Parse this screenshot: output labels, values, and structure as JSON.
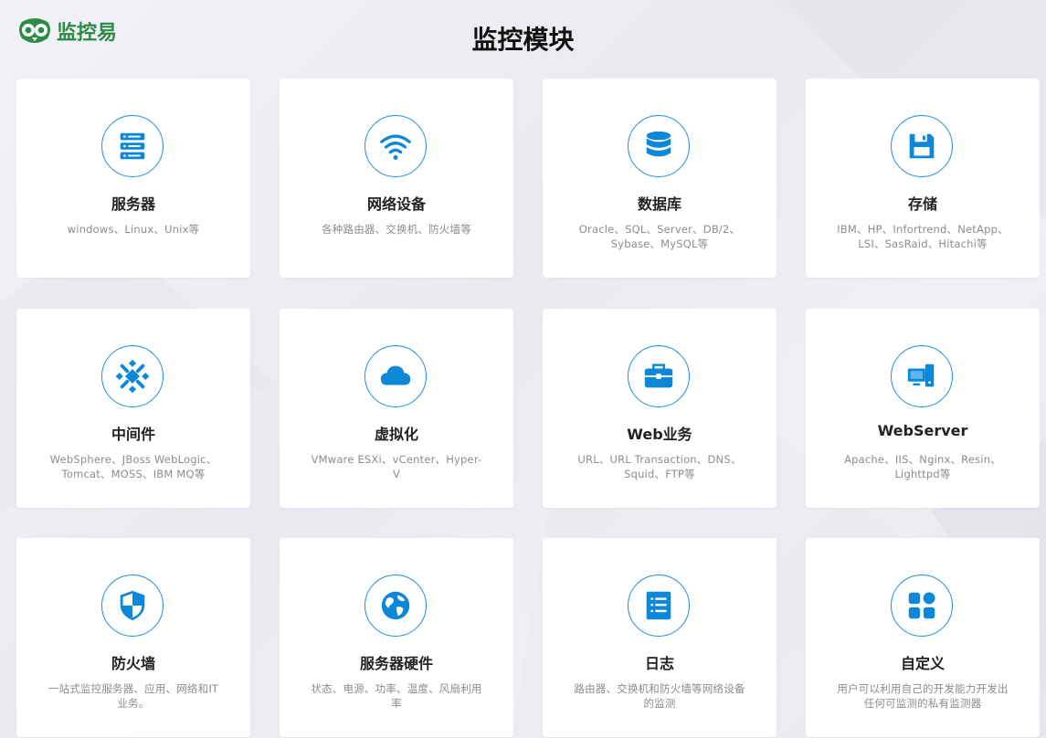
{
  "brand": {
    "name": "监控易",
    "color": "#2e8b47"
  },
  "page": {
    "title": "监控模块"
  },
  "accent": "#0d87d8",
  "modules": [
    {
      "title": "服务器",
      "desc": "windows、Linux、Unix等",
      "icon": "server-icon"
    },
    {
      "title": "网络设备",
      "desc": "各种路由器、交换机、防火墙等",
      "icon": "wifi-icon"
    },
    {
      "title": "数据库",
      "desc": "Oracle、SQL、Server、DB/2、Sybase、MySQL等",
      "icon": "database-icon"
    },
    {
      "title": "存储",
      "desc": "IBM、HP、Infortrend、NetApp、LSI、SasRaid、Hitachi等",
      "icon": "floppy-disk-icon"
    },
    {
      "title": "中间件",
      "desc": "WebSphere、JBoss WebLogic、Tomcat、MOSS、IBM MQ等",
      "icon": "middleware-icon"
    },
    {
      "title": "虚拟化",
      "desc": "VMware ESXi、vCenter、Hyper-V",
      "icon": "cloud-icon"
    },
    {
      "title": "Web业务",
      "desc": "URL、URL Transaction、DNS、Squid、FTP等",
      "icon": "briefcase-icon"
    },
    {
      "title": "WebServer",
      "desc": "Apache、IIS、Nginx、Resin、Lighttpd等",
      "icon": "monitor-icon"
    },
    {
      "title": "防火墙",
      "desc": "一站式监控服务器、应用、网络和IT 业务。",
      "icon": "shield-icon"
    },
    {
      "title": "服务器硬件",
      "desc": "状态、电源、功率、温度、风扇利用率",
      "icon": "globe-icon"
    },
    {
      "title": "日志",
      "desc": "路由器、交换机和防火墙等网络设备 的监测",
      "icon": "log-list-icon"
    },
    {
      "title": "自定义",
      "desc": "用户可以利用自己的开发能力开发出 任何可监测的私有监测器",
      "icon": "apps-grid-icon"
    }
  ]
}
